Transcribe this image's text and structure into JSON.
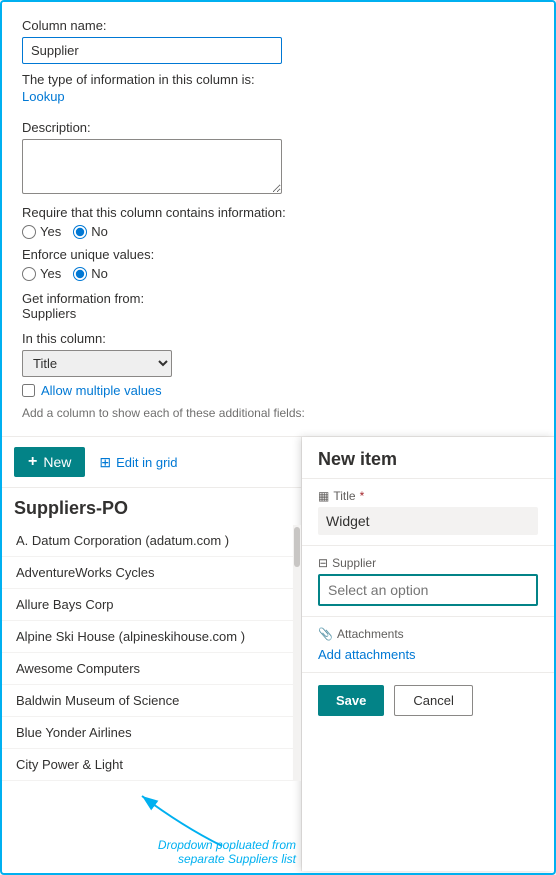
{
  "form": {
    "column_name_label": "Column name:",
    "column_name_value": "Supplier",
    "column_name_placeholder": "Supplier",
    "type_info_label": "The type of information in this column is:",
    "type_value": "Lookup",
    "description_label": "Description:",
    "description_placeholder": "",
    "require_label": "Require that this column contains information:",
    "require_yes": "Yes",
    "require_no": "No",
    "enforce_label": "Enforce unique values:",
    "enforce_yes": "Yes",
    "enforce_no": "No",
    "get_info_label": "Get information from:",
    "get_info_value": "Suppliers",
    "in_column_label": "In this column:",
    "in_column_value": "Title",
    "allow_multiple_label": "Allow multiple values",
    "add_column_hint": "Add a column to show each of these additional fields:"
  },
  "toolbar": {
    "new_button_label": "New",
    "edit_grid_label": "Edit in grid"
  },
  "list": {
    "title": "Suppliers-PO",
    "items": [
      "A. Datum Corporation (adatum.com )",
      "AdventureWorks Cycles",
      "Allure Bays Corp",
      "Alpine Ski House (alpineskihouse.com )",
      "Awesome Computers",
      "Baldwin Museum of Science",
      "Blue Yonder Airlines",
      "City Power & Light"
    ]
  },
  "new_item_panel": {
    "header": "New item",
    "title_label": "Title",
    "title_required": "*",
    "title_value": "Widget",
    "supplier_label": "Supplier",
    "supplier_placeholder": "Select an option",
    "attachments_label": "Attachments",
    "add_attachments_label": "Add attachments",
    "save_label": "Save",
    "cancel_label": "Cancel"
  },
  "annotation": {
    "text": "Dropdown popluated from separate Suppliers list"
  },
  "icons": {
    "plus": "+",
    "grid": "⊞",
    "title_icon": "▦",
    "supplier_icon": "⊟",
    "paperclip": "📎"
  }
}
